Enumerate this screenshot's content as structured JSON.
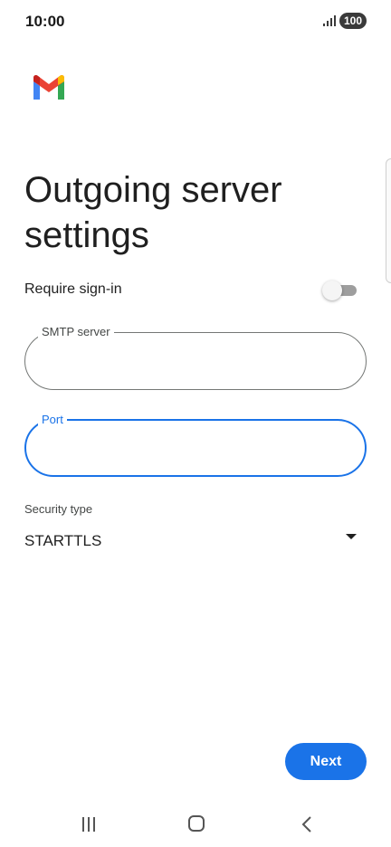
{
  "status_bar": {
    "time": "10:00",
    "battery": "100",
    "signal_icon": "signal-bars-icon"
  },
  "header": {
    "logo_icon": "gmail-logo-icon",
    "title": "Outgoing server settings"
  },
  "form": {
    "require_signin": {
      "label": "Require sign-in",
      "enabled": false
    },
    "smtp_server": {
      "label": "SMTP server",
      "value": ""
    },
    "port": {
      "label": "Port",
      "value": "",
      "focused": true
    },
    "security_type": {
      "label": "Security type",
      "selected": "STARTTLS"
    }
  },
  "actions": {
    "next_label": "Next"
  },
  "nav_bar": {
    "recents_icon": "recents-icon",
    "home_icon": "home-icon",
    "back_icon": "back-icon"
  },
  "colors": {
    "accent": "#1a73e8",
    "text": "#1f1f1f",
    "outline": "#747775"
  }
}
